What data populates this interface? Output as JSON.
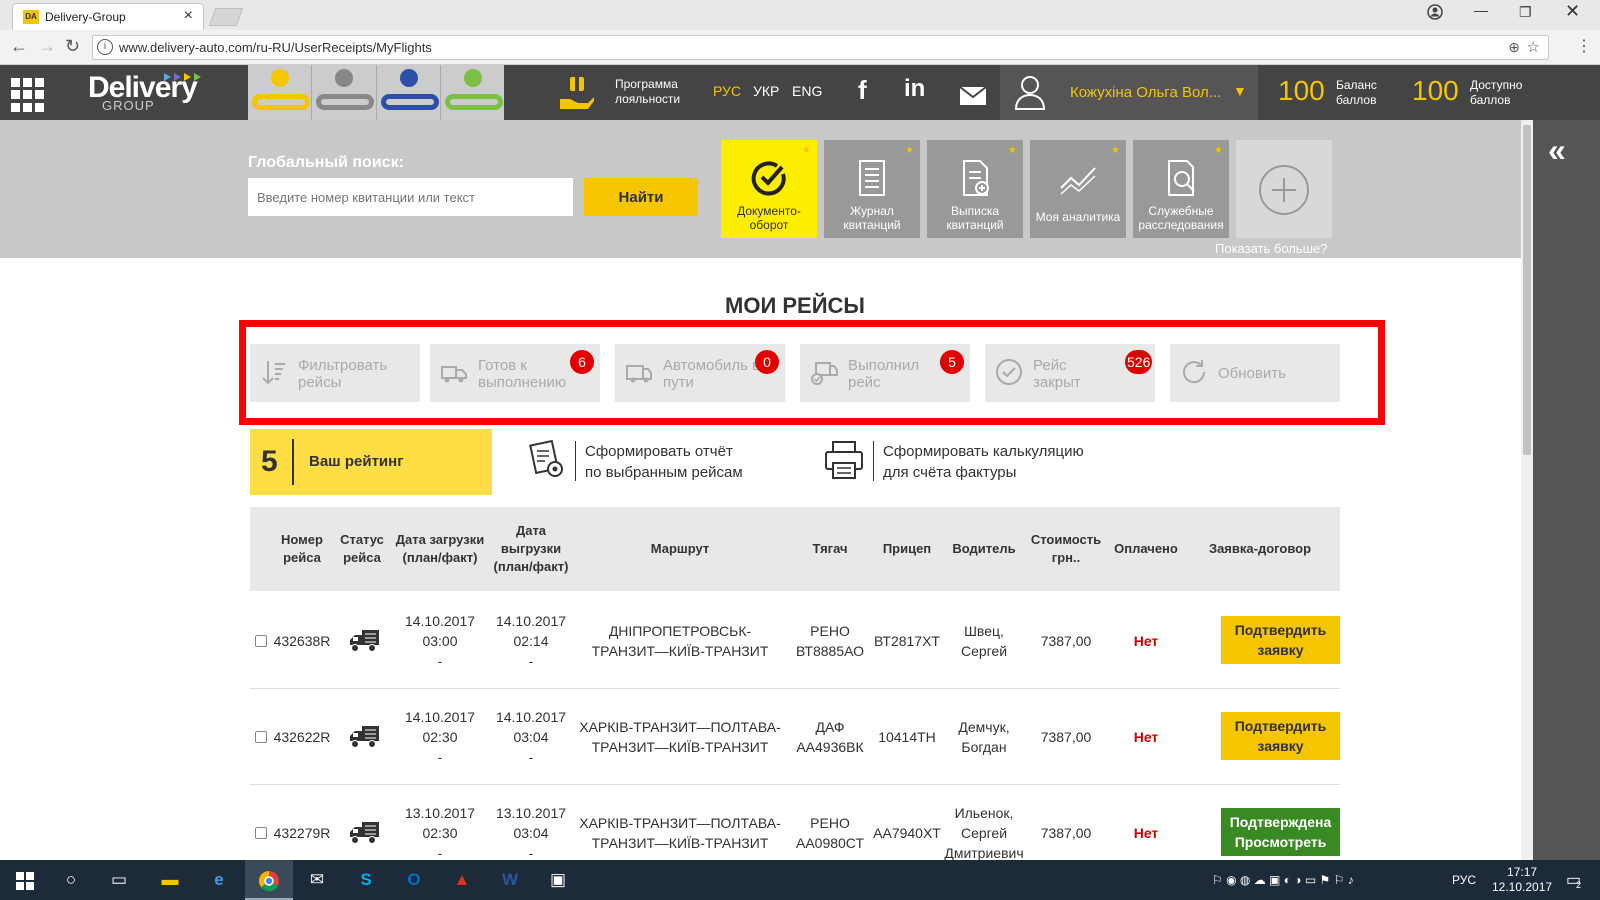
{
  "browser": {
    "tab_title": "Delivery-Group",
    "tab_favicon": "DA",
    "url": "www.delivery-auto.com/ru-RU/UserReceipts/MyFlights"
  },
  "header": {
    "logo": "Delivery",
    "logo_sub": "GROUP",
    "loyalty_label": "Программа лояльности",
    "langs": [
      "РУС",
      "УКР",
      "ENG"
    ],
    "social_icons": [
      "facebook-icon",
      "linkedin-icon",
      "mail-icon"
    ],
    "user_name": "Кожухіна Ольга Вол...",
    "balance_value": "100",
    "balance_label": "Баланс баллов",
    "available_value": "100",
    "available_label": "Доступно баллов",
    "accent_color": "#f5c500"
  },
  "search": {
    "label": "Глобальный поиск:",
    "placeholder": "Введите номер квитанции или текст",
    "button": "Найти"
  },
  "tiles": [
    {
      "label": "Документо-оборот",
      "icon": "check-circle-icon"
    },
    {
      "label": "Журнал квитанций",
      "icon": "journal-icon"
    },
    {
      "label": "Выписка квитанций",
      "icon": "document-add-icon"
    },
    {
      "label": "Моя аналитика",
      "icon": "chart-icon"
    },
    {
      "label": "Служебные расследования",
      "icon": "search-doc-icon"
    }
  ],
  "show_more": "Показать больше?",
  "page_title": "МОИ РЕЙСЫ",
  "filters": [
    {
      "label": "Фильтровать рейсы",
      "icon": "sort-icon",
      "badge": ""
    },
    {
      "label": "Готов к выполнению",
      "icon": "truck-icon",
      "badge": "6"
    },
    {
      "label": "Автомобиль в пути",
      "icon": "van-icon",
      "badge": "0"
    },
    {
      "label": "Выполнил рейс",
      "icon": "truck-check-icon",
      "badge": "5"
    },
    {
      "label": "Рейс закрыт",
      "icon": "check-circle-icon",
      "badge": "526"
    },
    {
      "label": "Обновить",
      "icon": "refresh-icon",
      "badge": ""
    }
  ],
  "rating": {
    "value": "5",
    "label": "Ваш рейтинг"
  },
  "actions": {
    "report": "Сформировать отчёт по выбранным рейсам",
    "report_l1": "Сформировать отчёт",
    "report_l2": "по выбранным рейсам",
    "calc_l1": "Сформировать калькуляцию",
    "calc_l2": "для счёта фактуры"
  },
  "table": {
    "headers": {
      "num": "Номер рейса",
      "status": "Статус рейса",
      "load": "Дата загрузки (план/факт)",
      "unload": "Дата выгрузки (план/факт)",
      "route": "Маршрут",
      "tractor": "Тягач",
      "trailer": "Прицеп",
      "driver": "Водитель",
      "cost": "Стоимость грн..",
      "paid": "Оплачено",
      "contract": "Заявка-договор"
    },
    "rows": [
      {
        "num": "432638R",
        "load_date": "14.10.2017",
        "load_time": "03:00",
        "load_fact": "-",
        "unload_date": "14.10.2017",
        "unload_time": "02:14",
        "unload_fact": "-",
        "route": "ДНІПРОПЕТРОВСЬК-ТРАНЗИТ—КИЇВ-ТРАНЗИТ",
        "tractor": "РЕНО ВТ8885АО",
        "trailer": "ВТ2817ХТ",
        "driver": "Швец, Сергей",
        "cost": "7387,00",
        "paid": "Нет",
        "action": "Подтвердить заявку",
        "action_state": "pending"
      },
      {
        "num": "432622R",
        "load_date": "14.10.2017",
        "load_time": "02:30",
        "load_fact": "-",
        "unload_date": "14.10.2017",
        "unload_time": "03:04",
        "unload_fact": "-",
        "route": "ХАРКІВ-ТРАНЗИТ—ПОЛТАВА-ТРАНЗИТ—КИЇВ-ТРАНЗИТ",
        "tractor": "ДАФ АА4936ВК",
        "trailer": "10414ТН",
        "driver": "Демчук, Богдан",
        "cost": "7387,00",
        "paid": "Нет",
        "action": "Подтвердить заявку",
        "action_state": "pending"
      },
      {
        "num": "432279R",
        "load_date": "13.10.2017",
        "load_time": "02:30",
        "load_fact": "-",
        "unload_date": "13.10.2017",
        "unload_time": "03:04",
        "unload_fact": "-",
        "route": "ХАРКІВ-ТРАНЗИТ—ПОЛТАВА-ТРАНЗИТ—КИЇВ-ТРАНЗИТ",
        "tractor": "РЕНО АА0980СТ",
        "trailer": "АА7940ХТ",
        "driver": "Ильенок, Сергей Дмитриевич",
        "cost": "7387,00",
        "paid": "Нет",
        "action": "Подтверждена Просмотреть",
        "action_state": "confirmed"
      }
    ]
  },
  "taskbar": {
    "lang": "РУС",
    "time": "17:17",
    "date": "12.10.2017",
    "notifications": "2"
  }
}
